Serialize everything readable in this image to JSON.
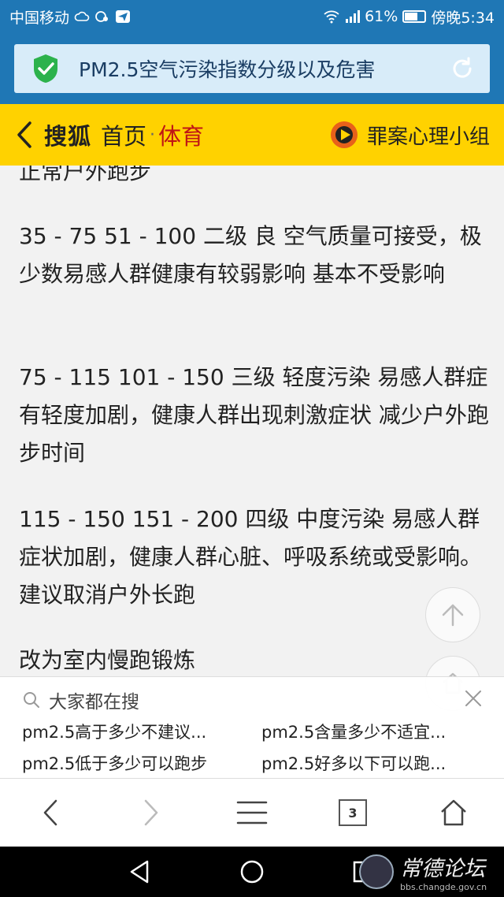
{
  "status_bar": {
    "carrier": "中国移动",
    "battery": "61%",
    "battery_level": 0.61,
    "time": "傍晚5:34"
  },
  "address_bar": {
    "page_title": "PM2.5空气污染指数分级以及危害"
  },
  "site_header": {
    "brand": "搜狐",
    "home": "首页",
    "separator": "·",
    "section": "体育",
    "right_label": "罪案心理小组"
  },
  "article": {
    "paragraphs": [
      "正常户外跑步",
      "35 - 75  51 - 100  二级  良  空气质量可接受，极少数易感人群健康有较弱影响  基本不受影响",
      "75 - 115 101 - 150 三级 轻度污染 易感人群症有轻度加剧，健康人群出现刺激症状 减少户外跑步时间",
      "115 - 150  151 - 200  四级  中度污染  易感人群症状加剧，健康人群心脏、呼吸系统或受影响。建议取消户外长跑",
      "改为室内慢跑锻炼"
    ]
  },
  "suggestions": {
    "header": "大家都在搜",
    "items": [
      "pm2.5高于多少不建议...",
      "pm2.5含量多少不适宜...",
      "pm2.5低于多少可以跑步",
      "pm2.5好多以下可以跑..."
    ]
  },
  "toolbar": {
    "tab_count": "3"
  },
  "watermark": {
    "title": "常德论坛",
    "url": "bbs.changde.gov.cn"
  },
  "colors": {
    "status_bar": "#1f77b5",
    "address_bg": "#d8ecf9",
    "header_yellow": "#ffd200",
    "section_red": "#c01515",
    "shield_green": "#2cb24c"
  }
}
